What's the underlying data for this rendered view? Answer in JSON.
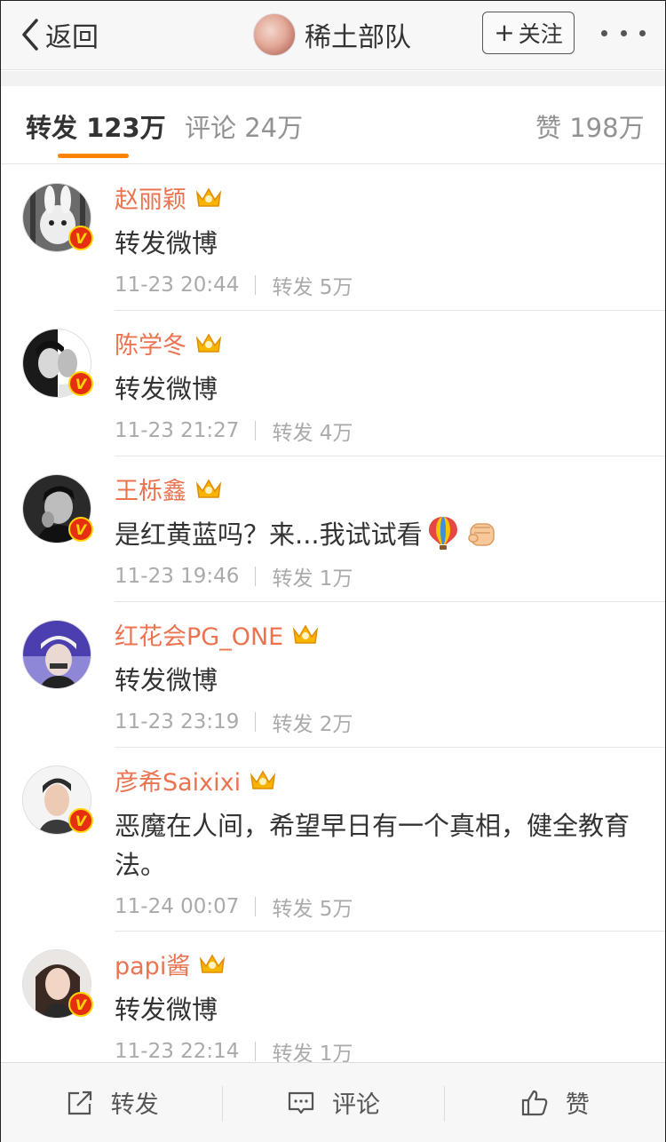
{
  "nav": {
    "back_label": "返回",
    "title": "稀土部队",
    "follow_label": "关注",
    "follow_plus": "+"
  },
  "tabs": {
    "repost": "转发 123万",
    "comment": "评论 24万",
    "like": "赞 198万"
  },
  "items": [
    {
      "name": "赵丽颖",
      "text": "转发微博",
      "time": "11-23 20:44",
      "repost": "转发 5万",
      "verified": "V"
    },
    {
      "name": "陈学冬",
      "text": "转发微博",
      "time": "11-23 21:27",
      "repost": "转发 4万",
      "verified": "V"
    },
    {
      "name": "王栎鑫",
      "text": "是红黄蓝吗？来...我试试看",
      "time": "11-23 19:46",
      "repost": "转发 1万",
      "verified": "V"
    },
    {
      "name": "红花会PG_ONE",
      "text": "转发微博",
      "time": "11-23 23:19",
      "repost": "转发 2万",
      "verified": ""
    },
    {
      "name": "彦希Saixixi",
      "text": "恶魔在人间，希望早日有一个真相，健全教育法。",
      "time": "11-24 00:07",
      "repost": "转发 5万",
      "verified": "V"
    },
    {
      "name": "papi酱",
      "text": "转发微博",
      "time": "11-23 22:14",
      "repost": "转发 1万",
      "verified": "V"
    }
  ],
  "bottom": {
    "repost": "转发",
    "comment": "评论",
    "like": "赞"
  },
  "colors": {
    "accent": "#ff8200",
    "name": "#eb7350",
    "meta": "#aaaaaa"
  }
}
